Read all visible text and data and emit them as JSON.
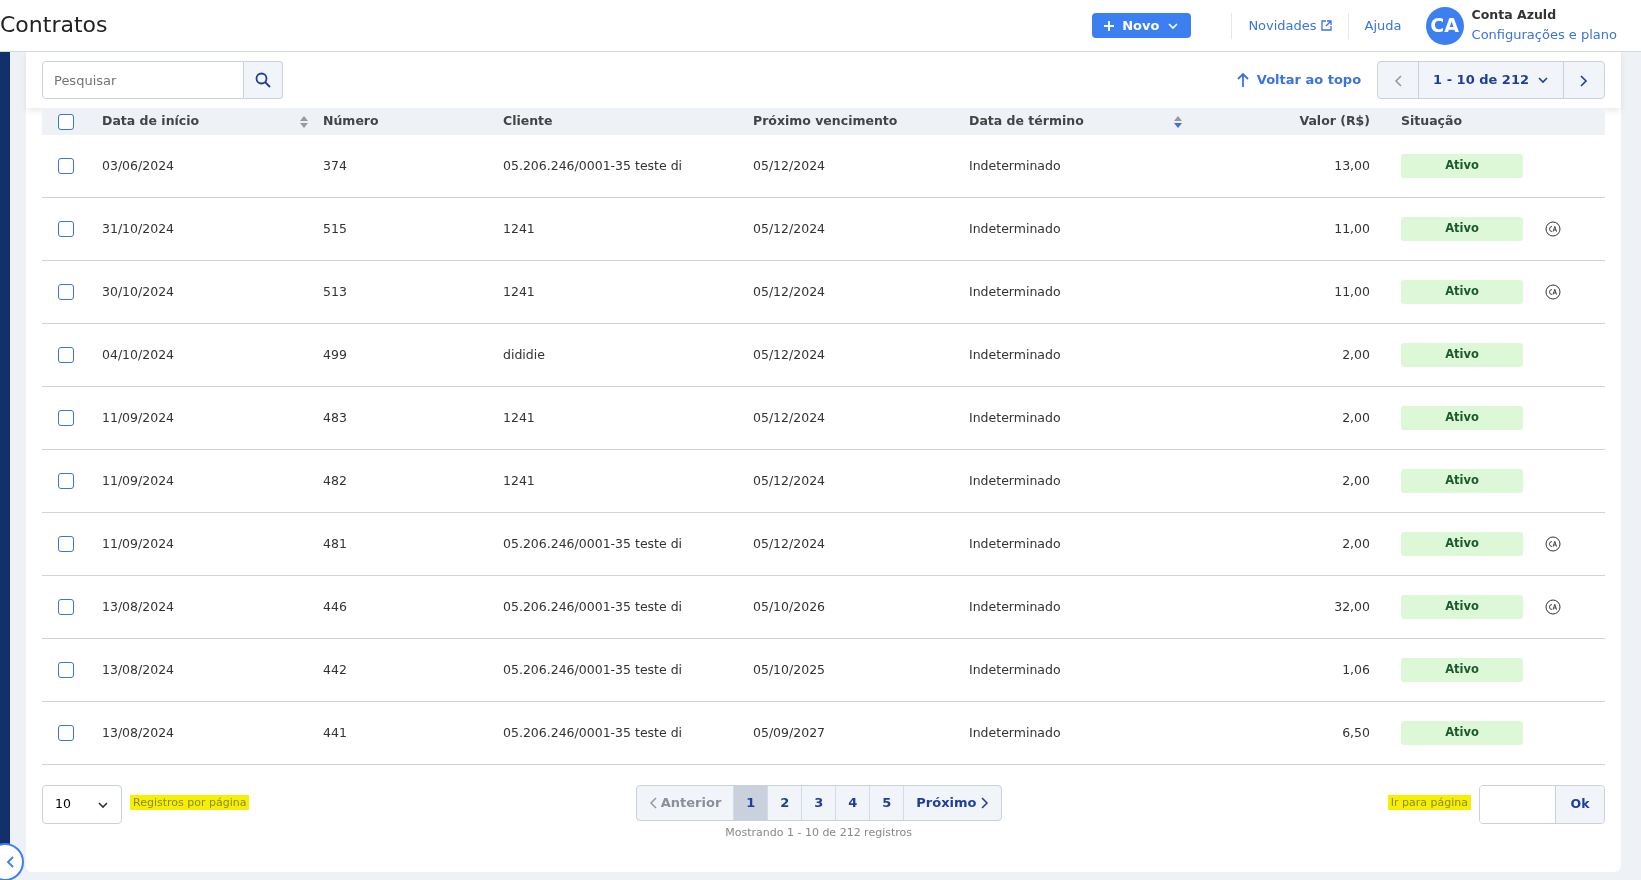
{
  "header": {
    "title": "Contratos",
    "new_button": "Novo",
    "links": [
      {
        "label": "Novidades",
        "external": true
      },
      {
        "label": "Ajuda",
        "external": false
      }
    ],
    "account": {
      "initials": "CA",
      "name": "Conta Azuld",
      "subtitle": "Configurações e plano"
    }
  },
  "toolbar": {
    "search": {
      "placeholder": "Pesquisar"
    },
    "back_to_top": "Voltar ao topo",
    "range": "1 - 10 de 212"
  },
  "table": {
    "columns": [
      {
        "label": "Data de início",
        "sorted": false
      },
      {
        "label": "Número"
      },
      {
        "label": "Cliente"
      },
      {
        "label": "Próximo vencimento"
      },
      {
        "label": "Data de término",
        "sorted": true
      },
      {
        "label": "Valor (R$)"
      },
      {
        "label": "Situação"
      }
    ],
    "all_checked": false,
    "rows": [
      {
        "checked": false,
        "cells": [
          "03/06/2024",
          "374",
          "05.206.246/0001-35 teste di",
          "05/12/2024",
          "Indeterminado",
          "13,00"
        ],
        "status": "Ativo",
        "ca_mark": false
      },
      {
        "checked": false,
        "cells": [
          "31/10/2024",
          "515",
          "1241",
          "05/12/2024",
          "Indeterminado",
          "11,00"
        ],
        "status": "Ativo",
        "ca_mark": true
      },
      {
        "checked": false,
        "cells": [
          "30/10/2024",
          "513",
          "1241",
          "05/12/2024",
          "Indeterminado",
          "11,00"
        ],
        "status": "Ativo",
        "ca_mark": true
      },
      {
        "checked": false,
        "cells": [
          "04/10/2024",
          "499",
          "dididie",
          "05/12/2024",
          "Indeterminado",
          "2,00"
        ],
        "status": "Ativo",
        "ca_mark": false
      },
      {
        "checked": false,
        "cells": [
          "11/09/2024",
          "483",
          "1241",
          "05/12/2024",
          "Indeterminado",
          "2,00"
        ],
        "status": "Ativo",
        "ca_mark": false
      },
      {
        "checked": false,
        "cells": [
          "11/09/2024",
          "482",
          "1241",
          "05/12/2024",
          "Indeterminado",
          "2,00"
        ],
        "status": "Ativo",
        "ca_mark": false
      },
      {
        "checked": false,
        "cells": [
          "11/09/2024",
          "481",
          "05.206.246/0001-35 teste di",
          "05/12/2024",
          "Indeterminado",
          "2,00"
        ],
        "status": "Ativo",
        "ca_mark": true
      },
      {
        "checked": false,
        "cells": [
          "13/08/2024",
          "446",
          "05.206.246/0001-35 teste di",
          "05/10/2026",
          "Indeterminado",
          "32,00"
        ],
        "status": "Ativo",
        "ca_mark": true
      },
      {
        "checked": false,
        "cells": [
          "13/08/2024",
          "442",
          "05.206.246/0001-35 teste di",
          "05/10/2025",
          "Indeterminado",
          "1,06"
        ],
        "status": "Ativo",
        "ca_mark": false
      },
      {
        "checked": false,
        "cells": [
          "13/08/2024",
          "441",
          "05.206.246/0001-35 teste di",
          "05/09/2027",
          "Indeterminado",
          "6,50"
        ],
        "status": "Ativo",
        "ca_mark": false
      }
    ]
  },
  "footer": {
    "per_page": "10",
    "per_page_label": "Registros por página",
    "pagination": {
      "previous": {
        "label": "Anterior",
        "disabled": true
      },
      "pages": [
        {
          "label": "1",
          "selected": true
        },
        {
          "label": "2",
          "selected": false
        },
        {
          "label": "3",
          "selected": false
        },
        {
          "label": "4",
          "selected": false
        },
        {
          "label": "5",
          "selected": false
        }
      ],
      "next": {
        "label": "Próximo",
        "disabled": false
      }
    },
    "info": "Mostrando 1 - 10 de 212 registros",
    "goto_label": "Ir para página",
    "ok_button": "Ok"
  }
}
